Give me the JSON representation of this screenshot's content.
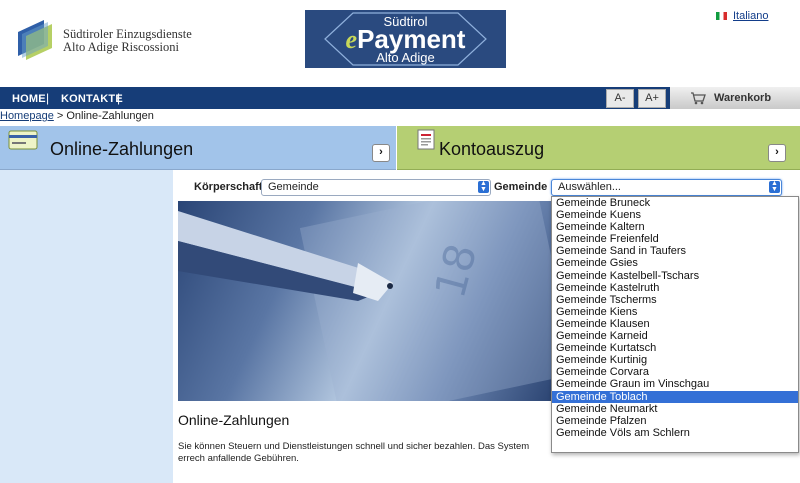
{
  "header": {
    "logo_line1": "Südtiroler Einzugsdienste",
    "logo_line2": "Alto Adige Riscossioni",
    "epayment_top": "Südtirol",
    "epayment_main_e": "e",
    "epayment_main_rest": "Payment",
    "epayment_bottom": "Alto Adige",
    "language_link": "Italiano"
  },
  "nav": {
    "home": "HOME",
    "contacts": "KONTAKTE",
    "separator": "|",
    "font_smaller": "A-",
    "font_larger": "A+",
    "cart": "Warenkorb"
  },
  "breadcrumb": {
    "home": "Homepage",
    "separator": " > ",
    "current": "Online-Zahlungen"
  },
  "banners": {
    "left_title": "Online-Zahlungen",
    "right_title": "Kontoauszug",
    "arrow": "›"
  },
  "form": {
    "koerperschaft_label": "Körperschaft",
    "koerperschaft_value": "Gemeinde",
    "gemeinde_label": "Gemeinde",
    "gemeinde_value": "Auswählen..."
  },
  "dropdown": {
    "selected_index": 17,
    "options": [
      "Gemeinde Bruneck",
      "Gemeinde Kuens",
      "Gemeinde Kaltern",
      "Gemeinde Freienfeld",
      "Gemeinde Sand in Taufers",
      "Gemeinde Gsies",
      "Gemeinde Kastelbell-Tschars",
      "Gemeinde Kastelruth",
      "Gemeinde Tscherms",
      "Gemeinde Kiens",
      "Gemeinde Klausen",
      "Gemeinde Karneid",
      "Gemeinde Kurtatsch",
      "Gemeinde Kurtinig",
      "Gemeinde Corvara",
      "Gemeinde Graun im Vinschgau",
      "Gemeinde Toblach",
      "Gemeinde Neumarkt",
      "Gemeinde Pfalzen",
      "Gemeinde Völs am Schlern"
    ]
  },
  "content": {
    "title": "Online-Zahlungen",
    "text": "Sie können Steuern und Dienstleistungen schnell und sicher bezahlen. Das System errech anfallende Gebühren."
  },
  "colors": {
    "nav_bg": "#163d78",
    "banner_left": "#a2c4ea",
    "banner_right": "#b5cf73",
    "selection": "#3470d6"
  },
  "icons": [
    "cart-icon",
    "card-icon",
    "document-icon",
    "flag-icon"
  ]
}
